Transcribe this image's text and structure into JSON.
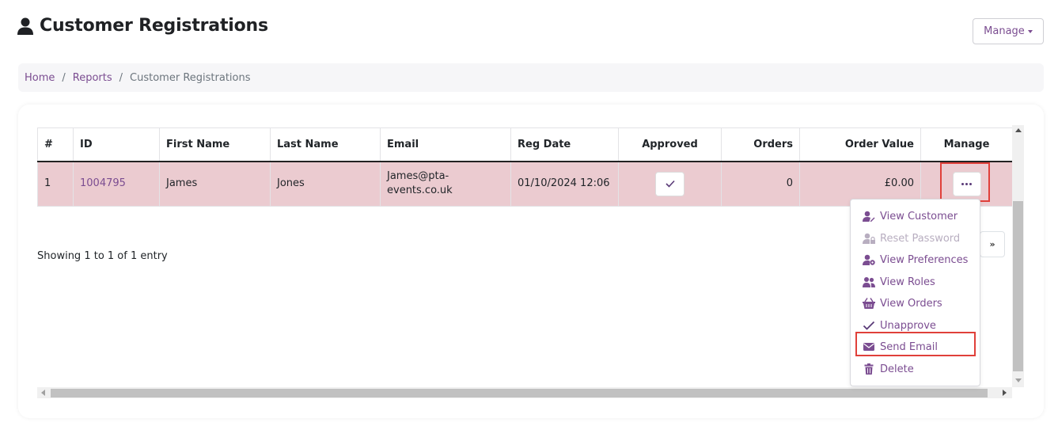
{
  "header": {
    "title": "Customer Registrations",
    "icon": "user-icon"
  },
  "manage_button": {
    "label": "Manage"
  },
  "breadcrumb": [
    {
      "label": "Home",
      "link": true
    },
    {
      "label": "Reports",
      "link": true
    },
    {
      "label": "Customer Registrations",
      "link": false
    }
  ],
  "table": {
    "columns": [
      "#",
      "ID",
      "First Name",
      "Last Name",
      "Email",
      "Reg Date",
      "Approved",
      "Orders",
      "Order Value",
      "Manage"
    ],
    "rows": [
      {
        "num": "1",
        "id": "1004795",
        "first": "James",
        "last": "Jones",
        "email": "James@pta-events.co.uk",
        "reg_date": "01/10/2024 12:06",
        "approved": true,
        "orders": "0",
        "order_value": "£0.00"
      }
    ]
  },
  "info": {
    "showing": "Showing 1 to 1 of 1 entry"
  },
  "pagination": {
    "next": "»"
  },
  "dropdown": {
    "items": [
      {
        "label": "View Customer",
        "icon": "user-edit-icon",
        "disabled": false
      },
      {
        "label": "Reset Password",
        "icon": "user-lock-icon",
        "disabled": true
      },
      {
        "label": "View Preferences",
        "icon": "user-cog-icon",
        "disabled": false
      },
      {
        "label": "View Roles",
        "icon": "users-icon",
        "disabled": false
      },
      {
        "label": "View Orders",
        "icon": "basket-icon",
        "disabled": false
      },
      {
        "label": "Unapprove",
        "icon": "check-icon",
        "disabled": false
      },
      {
        "label": "Send Email",
        "icon": "envelope-icon",
        "disabled": false
      },
      {
        "label": "Delete",
        "icon": "trash-icon",
        "disabled": false
      }
    ]
  },
  "colors": {
    "accent": "#7b4d91",
    "row_highlight": "#ebcbd0",
    "annotation": "#e0403a"
  }
}
